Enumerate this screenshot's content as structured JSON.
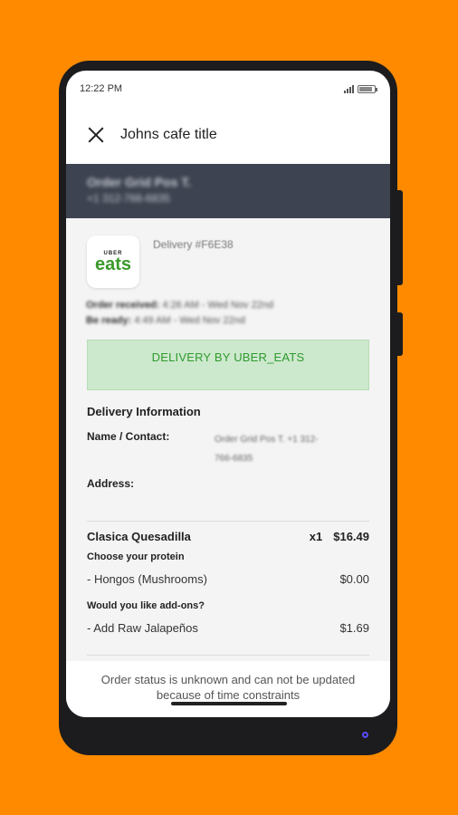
{
  "status_bar": {
    "time": "12:22 PM"
  },
  "header": {
    "title": "Johns cafe title"
  },
  "customer": {
    "name": "Order Grid Pos T.",
    "phone": "+1 312-766-6835"
  },
  "order": {
    "logo_top": "UBER",
    "logo_bottom": "eats",
    "delivery_id": "Delivery #F6E38",
    "received_label": "Order received:",
    "received_value": "4:26 AM - Wed Nov 22nd",
    "ready_label": "Be ready:",
    "ready_value": "4:49 AM - Wed Nov 22nd",
    "banner": "DELIVERY BY UBER_EATS"
  },
  "delivery_info": {
    "title": "Delivery Information",
    "name_label": "Name / Contact:",
    "name_value": "Order Grid Pos T. +1 312-766-6835",
    "address_label": "Address:"
  },
  "items": {
    "item1": {
      "name": "Clasica Quesadilla",
      "qty": "x1",
      "price": "$16.49"
    },
    "option1_title": "Choose your protein",
    "option1": {
      "name": "- Hongos (Mushrooms)",
      "price": "$0.00"
    },
    "option2_title": "Would you like add-ons?",
    "option2": {
      "name": "- Add Raw Jalapeños",
      "price": "$1.69"
    }
  },
  "footer": {
    "message": "Order status is unknown and can not be updated because of time constraints"
  },
  "colors": {
    "background": "#FF8A00",
    "banner_text": "#2e9a2e",
    "banner_bg": "#cde9cd",
    "customer_bar": "#3d4350"
  }
}
